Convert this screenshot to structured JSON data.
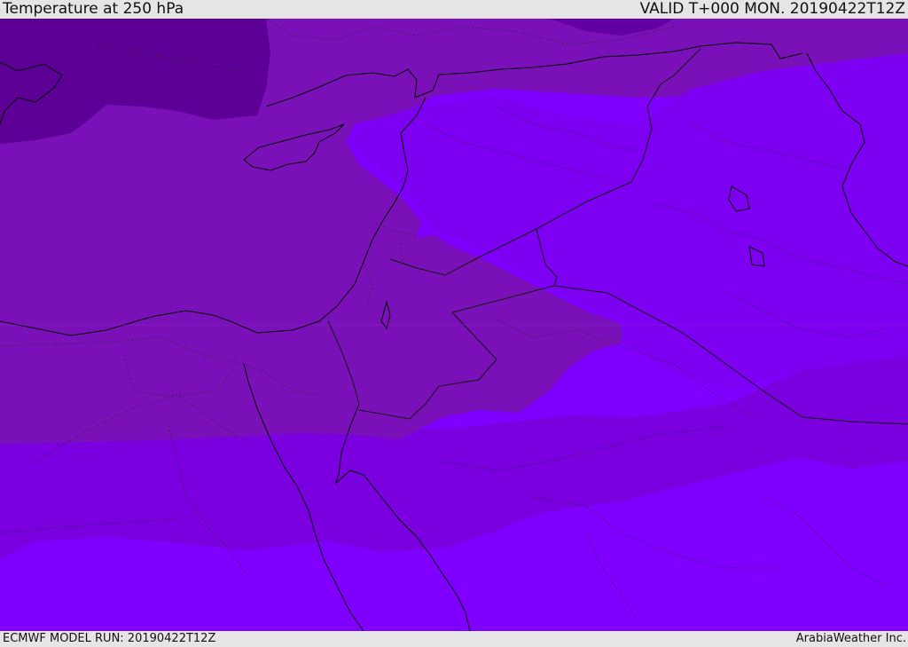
{
  "header": {
    "title": "Temperature at 250 hPa",
    "valid_time": "VALID T+000 MON. 20190422T12Z"
  },
  "footer": {
    "model_run": "ECMWF MODEL RUN: 20190422T12Z",
    "credit": "ArabiaWeather Inc."
  },
  "map": {
    "colors": {
      "coldest": "#5c0096",
      "cold": "#6800ac",
      "mid": "#7a10b8",
      "medium": "#8000e6",
      "warm": "#7a00f0",
      "warmest": "#8000ff"
    },
    "layers": [
      "temperature-fill",
      "coastlines",
      "country-borders",
      "province-borders"
    ]
  }
}
